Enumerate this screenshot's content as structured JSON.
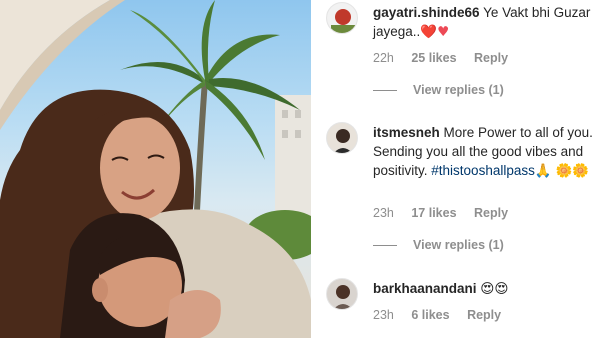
{
  "comments": [
    {
      "username": "gayatri.shinde66",
      "text": "Ye Vakt bhi Guzar jayega..",
      "emoji": "❤️♥",
      "time": "22h",
      "likes": "25 likes",
      "reply": "Reply",
      "view_replies": "View replies (1)"
    },
    {
      "username": "itsmesneh",
      "text": "More Power to all of you. Sending you all the good vibes and positivity.",
      "hashtag": "#thistooshallpass",
      "emoji_after_hashtag": "🙏",
      "emoji_tail": "🌼🌼",
      "time": "23h",
      "likes": "17 likes",
      "reply": "Reply",
      "view_replies": "View replies (1)"
    },
    {
      "username": "barkhaanandani",
      "text": "",
      "emoji": "😍😍",
      "time": "23h",
      "likes": "6 likes",
      "reply": "Reply"
    }
  ],
  "colors": {
    "text": "#262626",
    "meta": "#8e8e8e",
    "hashtag": "#00376b",
    "heart": "#ed4956"
  }
}
